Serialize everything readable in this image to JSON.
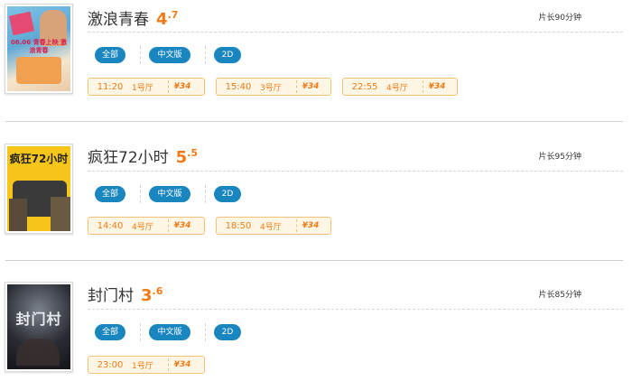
{
  "movies": [
    {
      "title": "激浪青春",
      "rating_int": "4",
      "rating_dec": ".7",
      "duration": "片长90分钟",
      "tags": [
        "全部",
        "中文版",
        "2D"
      ],
      "showtimes": [
        {
          "time": "11:20",
          "hall": "1号厅",
          "price": "¥34"
        },
        {
          "time": "15:40",
          "hall": "3号厅",
          "price": "¥34"
        },
        {
          "time": "22:55",
          "hall": "4号厅",
          "price": "¥34"
        }
      ],
      "poster_text": "06.06 青春上映 激浪青春",
      "poster_colors": [
        "#6fb2d8",
        "#e94a6a",
        "#f2e2c7"
      ]
    },
    {
      "title": "疯狂72小时",
      "rating_int": "5",
      "rating_dec": ".5",
      "duration": "片长95分钟",
      "tags": [
        "全部",
        "中文版",
        "2D"
      ],
      "showtimes": [
        {
          "time": "14:40",
          "hall": "4号厅",
          "price": "¥34"
        },
        {
          "time": "18:50",
          "hall": "4号厅",
          "price": "¥34"
        }
      ],
      "poster_text": "疯狂72小时",
      "poster_colors": [
        "#f6c51a",
        "#222222",
        "#3b3b3b"
      ]
    },
    {
      "title": "封门村",
      "rating_int": "3",
      "rating_dec": ".6",
      "duration": "片长85分钟",
      "tags": [
        "全部",
        "中文版",
        "2D"
      ],
      "showtimes": [
        {
          "time": "23:00",
          "hall": "1号厅",
          "price": "¥34"
        }
      ],
      "poster_text": "封门村",
      "poster_colors": [
        "#1a1a22",
        "#6a6f78",
        "#c9ced6"
      ]
    }
  ],
  "colors": {
    "accent_orange": "#ef7a17",
    "tag_blue": "#1a86bf",
    "slot_border": "#efc278",
    "slot_bg": "#fef6e4"
  }
}
